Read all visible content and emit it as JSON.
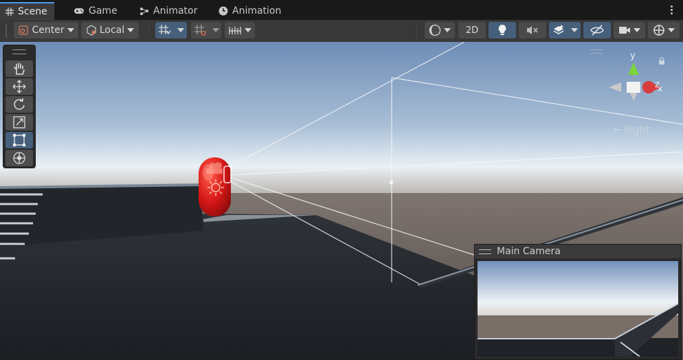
{
  "tabs": [
    {
      "label": "Scene",
      "icon": "grid-icon",
      "active": true
    },
    {
      "label": "Game",
      "icon": "gamepad-icon",
      "active": false
    },
    {
      "label": "Animator",
      "icon": "animator-icon",
      "active": false
    },
    {
      "label": "Animation",
      "icon": "clock-icon",
      "active": false
    }
  ],
  "toolbar": {
    "pivot_mode": "Center",
    "pivot_rotation": "Local",
    "toggle_2d": "2D"
  },
  "tools": [
    "hand",
    "move",
    "rotate",
    "scale",
    "rect",
    "transform"
  ],
  "active_tool": "rect",
  "gizmo": {
    "axis_y": "y",
    "axis_z": "z",
    "axis_x": "x",
    "view_label": "← Right"
  },
  "camera_preview": {
    "title": "Main Camera"
  },
  "colors": {
    "accent": "#4a9bf0",
    "active_button": "#46607c",
    "axis_y": "#7cd33a",
    "axis_x": "#e04040"
  }
}
